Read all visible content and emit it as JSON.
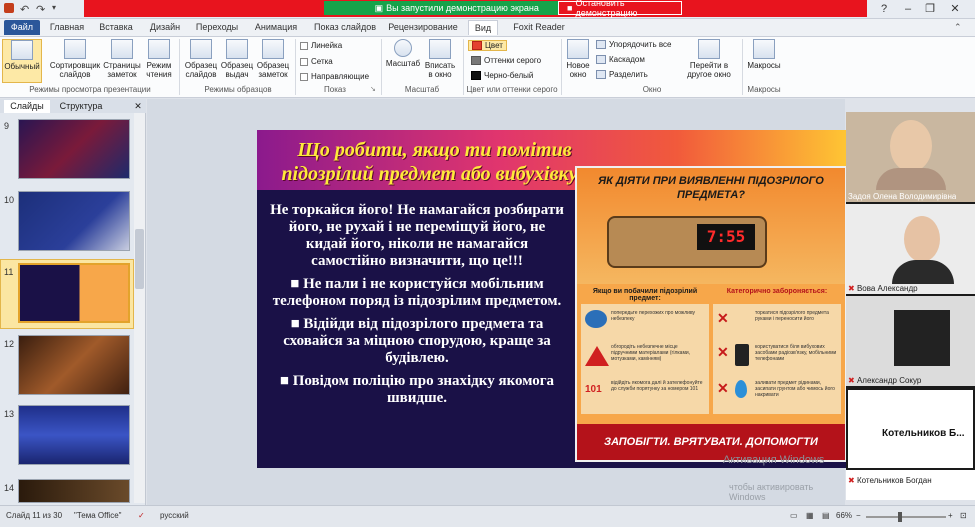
{
  "share_bar": {
    "started": "Вы запустили демонстрацию экрана",
    "stop": "Остановить демонстрацию"
  },
  "tabs": [
    "Файл",
    "Главная",
    "Вставка",
    "Дизайн",
    "Переходы",
    "Анимация",
    "Показ слайдов",
    "Рецензирование",
    "Вид",
    "Foxit Reader PDF"
  ],
  "ribbon": {
    "presentation_views": {
      "label": "Режимы просмотра презентации",
      "buttons": [
        "Обычный",
        "Сортировщик слайдов",
        "Страницы заметок",
        "Режим чтения"
      ]
    },
    "master_views": {
      "label": "Режимы образцов",
      "buttons": [
        "Образец слайдов",
        "Образец выдач",
        "Образец заметок"
      ]
    },
    "show": {
      "label": "Показ",
      "items": [
        "Линейка",
        "Сетка",
        "Направляющие"
      ]
    },
    "zoom": {
      "label": "Масштаб",
      "buttons": [
        "Масштаб",
        "Вписать в окно"
      ]
    },
    "color": {
      "label": "Цвет или оттенки серого",
      "items": [
        "Цвет",
        "Оттенки серого",
        "Черно-белый"
      ]
    },
    "window": {
      "label": "Окно",
      "new": "Новое окно",
      "items": [
        "Упорядочить все",
        "Каскадом",
        "Разделить"
      ],
      "switch": "Перейти в другое окно"
    },
    "macros": {
      "label": "Макросы",
      "button": "Макросы"
    }
  },
  "left_panel": {
    "tabs": [
      "Слайды",
      "Структура"
    ],
    "slide_numbers": [
      "9",
      "10",
      "11",
      "12",
      "13",
      "14"
    ]
  },
  "slide": {
    "title": "Що робити, якщо ти помітив підозрілий предмет або вибухівку?",
    "body": [
      "Не торкайся його! Не намагайся розбирати його, не рухай і не переміщуй його, не кидай його, ніколи не намагайся самостійно визначити, що це!!!",
      "■ Не пали і не користуйся мобільним телефоном поряд із підозрілим предметом.",
      "■ Відійди від підозрілого предмета та сховайся за міцною спорудою, краще за будівлею.",
      "■ Повідом поліцію про знахідку якомога швидше."
    ],
    "poster": {
      "title": "ЯК ДІЯТИ ПРИ ВИЯВЛЕННІ ПІДОЗРІЛОГО ПРЕДМЕТА?",
      "timer": "7:55",
      "left_head": "Якщо ви побачили підозрілий предмет:",
      "right_head": "Категорично забороняється:",
      "left_rows": [
        "попередьте перехожих про можливу небезпеку",
        "обгородіть небезпечне місце підручними матеріалами (гілками, мотузками, камінням)",
        "відійдіть якомога далі й зателефонуйте до служби порятунку за номером 101"
      ],
      "right_rows": [
        "торкатися підозрілого предмета руками і переносити його",
        "користуватися біля вибухових засобами радіозв'язку, мобільними телефонами",
        "заливати предмет рідинами, засипати грунтом або чимось його накривати"
      ],
      "badge": "101",
      "footer": "ЗАПОБІГТИ. ВРЯТУВАТИ. ДОПОМОГТИ"
    }
  },
  "watermark": {
    "line1": "Активация Windows",
    "line2": "чтобы активировать Windows"
  },
  "participants": [
    {
      "name": "Задоя Олена Володимирівна",
      "muted": false
    },
    {
      "name": "Вова Александр",
      "muted": true
    },
    {
      "name": "Александр Сокур",
      "muted": true
    },
    {
      "name": "Котельников Б...",
      "muted": false,
      "large_label": true
    },
    {
      "name": "Котельников Богдан",
      "muted": true
    }
  ],
  "status": {
    "slide": "Слайд 11 из 30",
    "theme": "\"Тема Office\"",
    "lang": "русский",
    "zoom": "66%"
  },
  "colors": {
    "file_tab": "#2b579a",
    "share_red": "#e8141e",
    "share_green": "#16a34a",
    "slide_bg": "#1a1147",
    "title_yellow": "#ffea3a"
  }
}
